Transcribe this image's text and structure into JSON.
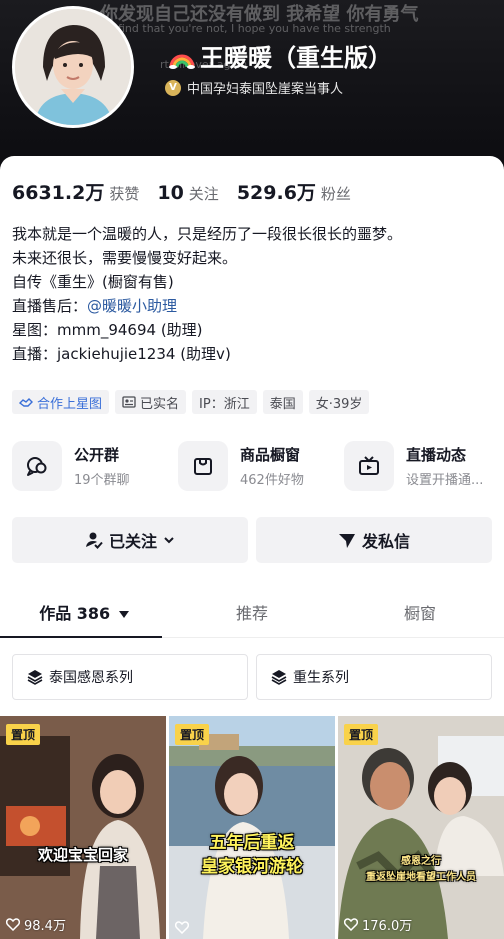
{
  "banner": {
    "line1": "你发现自己还没有做到 我希望 你有勇气",
    "line2": "find that you're not, I hope you have the strength",
    "line3": "rt all over again"
  },
  "profile": {
    "name": "王暖暖（重生版）",
    "verification": "中国孕妇泰国坠崖案当事人",
    "badge_glyph": "V"
  },
  "stats": [
    {
      "value": "6631.2万",
      "label": "获赞"
    },
    {
      "value": "10",
      "label": "关注"
    },
    {
      "value": "529.6万",
      "label": "粉丝"
    }
  ],
  "bio": {
    "line1": "我本就是一个温暖的人，只是经历了一段很长很长的噩梦。",
    "line2": "未来还很长，需要慢慢变好起来。",
    "line3": "自传《重生》(橱窗有售)",
    "line4_prefix": "直播售后：",
    "line4_mention": "@暖暖小助理",
    "line5": "星图：mmm_94694 (助理)",
    "line6": "直播：jackiehujie1234 (助理v)"
  },
  "tags": {
    "cooperation": "合作上星图",
    "real_name": "已实名",
    "ip": "IP：浙江",
    "country": "泰国",
    "gender_age": "女·39岁"
  },
  "features": [
    {
      "title": "公开群",
      "subtitle": "19个群聊",
      "icon": "group-chat-icon"
    },
    {
      "title": "商品橱窗",
      "subtitle": "462件好物",
      "icon": "shop-window-icon"
    },
    {
      "title": "直播动态",
      "subtitle": "设置开播通...",
      "icon": "live-tv-icon"
    }
  ],
  "actions": {
    "followed": "已关注",
    "message": "发私信"
  },
  "tabs": {
    "works": "作品 386",
    "recommend": "推荐",
    "window": "橱窗"
  },
  "series": {
    "s1": "泰国感恩系列",
    "s2": "重生系列"
  },
  "videos": [
    {
      "pinned": "置顶",
      "likes": "98.4万",
      "overlay1": "欢迎宝宝回家",
      "overlay2": ""
    },
    {
      "pinned": "置顶",
      "likes": "",
      "overlay1": "五年后重返",
      "overlay2": "皇家银河游轮"
    },
    {
      "pinned": "置顶",
      "likes": "176.0万",
      "overlay1": "感恩之行",
      "overlay2": "重返坠崖地看望工作人员"
    }
  ],
  "colors": {
    "accent_blue": "#2c5aa0",
    "pin_yellow": "#f9d24a",
    "text_primary": "#161823",
    "text_secondary": "#6a6b70"
  }
}
